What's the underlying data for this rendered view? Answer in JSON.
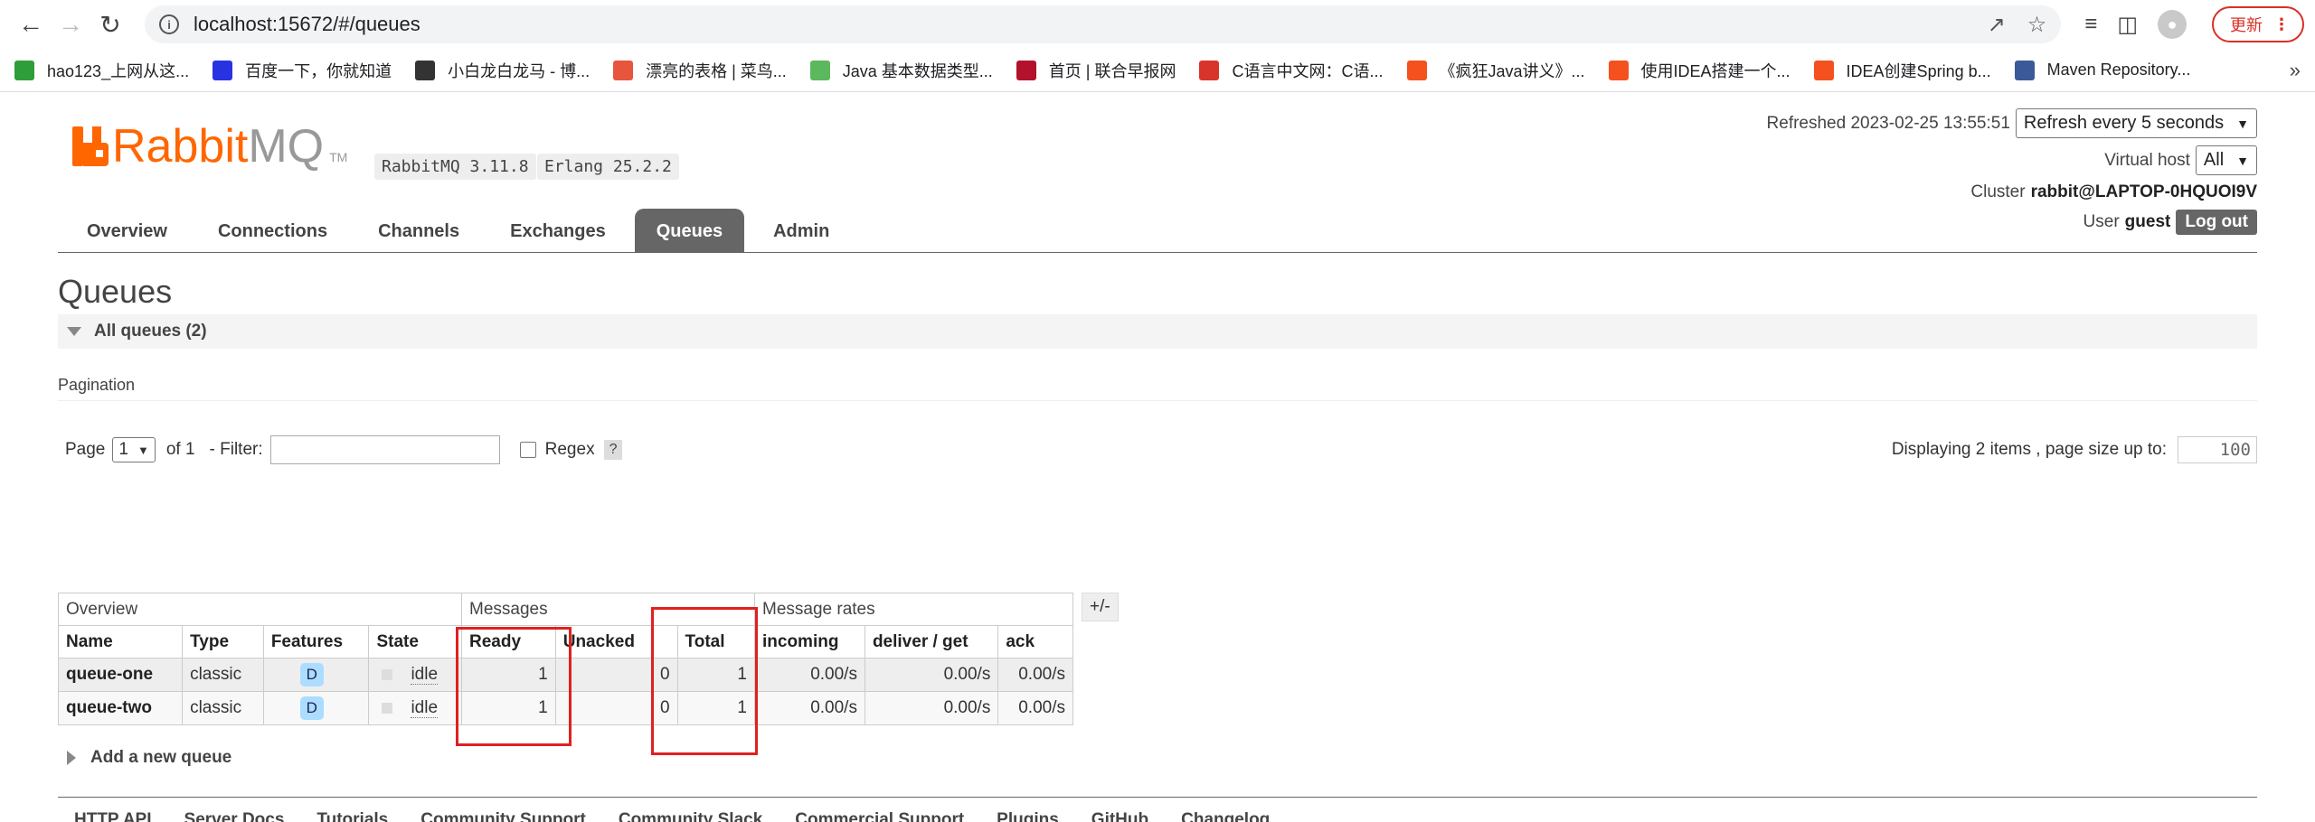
{
  "browser": {
    "url": "localhost:15672/#/queues",
    "update_label": "更新",
    "bookmarks": [
      {
        "label": "hao123_上网从这...",
        "icon": "hao123-icon",
        "color": "#2e9e3a"
      },
      {
        "label": "百度一下，你就知道",
        "icon": "baidu-paw-icon",
        "color": "#2932e1"
      },
      {
        "label": "小白龙白龙马 - 博...",
        "icon": "blog-icon",
        "color": "#333333"
      },
      {
        "label": "漂亮的表格 | 菜鸟...",
        "icon": "runoob-icon",
        "color": "#e8553d"
      },
      {
        "label": "Java 基本数据类型...",
        "icon": "runoob-green-icon",
        "color": "#5cb85c"
      },
      {
        "label": "首页 | 联合早报网",
        "icon": "zaobao-icon",
        "color": "#b3122c"
      },
      {
        "label": "C语言中文网：C语...",
        "icon": "c-site-icon",
        "color": "#d9342b"
      },
      {
        "label": "《疯狂Java讲义》...",
        "icon": "csdn-icon",
        "color": "#f4511e"
      },
      {
        "label": "使用IDEA搭建一个...",
        "icon": "csdn-icon",
        "color": "#f4511e"
      },
      {
        "label": "IDEA创建Spring b...",
        "icon": "csdn-icon",
        "color": "#f4511e"
      },
      {
        "label": "Maven Repository...",
        "icon": "maven-icon",
        "color": "#3b5998"
      }
    ],
    "more_label": "»"
  },
  "header": {
    "logo_rabbit": "Rabbit",
    "logo_mq": "MQ",
    "logo_tm": "TM",
    "rabbitmq_version": "RabbitMQ 3.11.8",
    "erlang_version": "Erlang 25.2.2",
    "refreshed_label": "Refreshed 2023-02-25 13:55:51",
    "refresh_select": "Refresh every 5 seconds",
    "virtual_host_label": "Virtual host",
    "virtual_host_value": "All",
    "cluster_label": "Cluster",
    "cluster_value": "rabbit@LAPTOP-0HQUOI9V",
    "user_label": "User",
    "user_value": "guest",
    "logout_label": "Log out",
    "tabs": [
      {
        "label": "Overview",
        "active": false
      },
      {
        "label": "Connections",
        "active": false
      },
      {
        "label": "Channels",
        "active": false
      },
      {
        "label": "Exchanges",
        "active": false
      },
      {
        "label": "Queues",
        "active": true
      },
      {
        "label": "Admin",
        "active": false
      }
    ]
  },
  "main": {
    "title": "Queues",
    "all_queues_label": "All queues (2)",
    "pagination_label": "Pagination",
    "page_label": "Page",
    "page_value": "1",
    "of_label": "of 1",
    "filter_label": "- Filter:",
    "regex_label": "Regex",
    "help_label": "?",
    "displaying_label": "Displaying 2 items , page size up to:",
    "page_size": "100",
    "plusminus_label": "+/-",
    "table": {
      "groups": [
        "Overview",
        "Messages",
        "Message rates"
      ],
      "columns": [
        "Name",
        "Type",
        "Features",
        "State",
        "Ready",
        "Unacked",
        "Total",
        "incoming",
        "deliver / get",
        "ack"
      ],
      "rows": [
        {
          "name": "queue-one",
          "type": "classic",
          "feature": "D",
          "state": "idle",
          "ready": "1",
          "unacked": "0",
          "total": "1",
          "incoming": "0.00/s",
          "deliver_get": "0.00/s",
          "ack": "0.00/s"
        },
        {
          "name": "queue-two",
          "type": "classic",
          "feature": "D",
          "state": "idle",
          "ready": "1",
          "unacked": "0",
          "total": "1",
          "incoming": "0.00/s",
          "deliver_get": "0.00/s",
          "ack": "0.00/s"
        }
      ]
    },
    "add_queue_label": "Add a new queue"
  },
  "footer": {
    "links": [
      "HTTP API",
      "Server Docs",
      "Tutorials",
      "Community Support",
      "Community Slack",
      "Commercial Support",
      "Plugins",
      "GitHub",
      "Changelog"
    ]
  },
  "colors": {
    "brand_orange": "#ff6600",
    "active_tab": "#666666",
    "annotation_red": "#e02020"
  }
}
